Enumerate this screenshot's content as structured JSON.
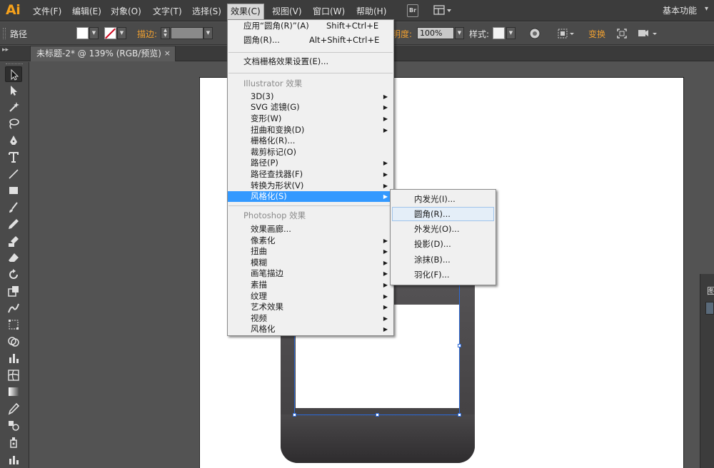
{
  "app": {
    "logo": "Ai",
    "workspace": "基本功能"
  },
  "menubar": {
    "items": [
      {
        "label": "文件(F)"
      },
      {
        "label": "编辑(E)"
      },
      {
        "label": "对象(O)"
      },
      {
        "label": "文字(T)"
      },
      {
        "label": "选择(S)"
      },
      {
        "label": "效果(C)"
      },
      {
        "label": "视图(V)"
      },
      {
        "label": "窗口(W)"
      },
      {
        "label": "帮助(H)"
      }
    ],
    "bridge_icon": "Br"
  },
  "controlbar": {
    "selection_kind": "路径",
    "stroke_label": "描边:",
    "opacity_label": "明度:",
    "opacity_value": "100%",
    "style_label": "样式:",
    "transform_label": "变换"
  },
  "document": {
    "tab_title": "未标题-2* @ 139% (RGB/预览)",
    "close_symbol": "×"
  },
  "effect_menu": {
    "top_items": [
      {
        "label": "应用“圆角(R)”(A)",
        "shortcut": "Shift+Ctrl+E"
      },
      {
        "label": "圆角(R)...",
        "shortcut": "Alt+Shift+Ctrl+E"
      }
    ],
    "document_raster_settings": "文档栅格效果设置(E)...",
    "illustrator_header": "Illustrator 效果",
    "illustrator_items": [
      {
        "label": "3D(3)",
        "submenu": true
      },
      {
        "label": "SVG 滤镜(G)",
        "submenu": true
      },
      {
        "label": "变形(W)",
        "submenu": true
      },
      {
        "label": "扭曲和变换(D)",
        "submenu": true
      },
      {
        "label": "栅格化(R)...",
        "submenu": false
      },
      {
        "label": "裁剪标记(O)",
        "submenu": false
      },
      {
        "label": "路径(P)",
        "submenu": true
      },
      {
        "label": "路径查找器(F)",
        "submenu": true
      },
      {
        "label": "转换为形状(V)",
        "submenu": true
      },
      {
        "label": "风格化(S)",
        "submenu": true,
        "highlighted": true
      }
    ],
    "photoshop_header": "Photoshop 效果",
    "photoshop_items": [
      {
        "label": "效果画廊...",
        "submenu": false
      },
      {
        "label": "像素化",
        "submenu": true
      },
      {
        "label": "扭曲",
        "submenu": true
      },
      {
        "label": "模糊",
        "submenu": true
      },
      {
        "label": "画笔描边",
        "submenu": true
      },
      {
        "label": "素描",
        "submenu": true
      },
      {
        "label": "纹理",
        "submenu": true
      },
      {
        "label": "艺术效果",
        "submenu": true
      },
      {
        "label": "视频",
        "submenu": true
      },
      {
        "label": "风格化",
        "submenu": true
      }
    ]
  },
  "stylize_submenu": {
    "items": [
      {
        "label": "内发光(I)..."
      },
      {
        "label": "圆角(R)...",
        "hover": true
      },
      {
        "label": "外发光(O)..."
      },
      {
        "label": "投影(D)..."
      },
      {
        "label": "涂抹(B)..."
      },
      {
        "label": "羽化(F)..."
      }
    ]
  },
  "right_dock": {
    "tab_label": "图"
  },
  "colors": {
    "accent_orange": "#f7a21b",
    "menu_highlight": "#3399ff",
    "selection_blue": "#2d6ad8"
  }
}
